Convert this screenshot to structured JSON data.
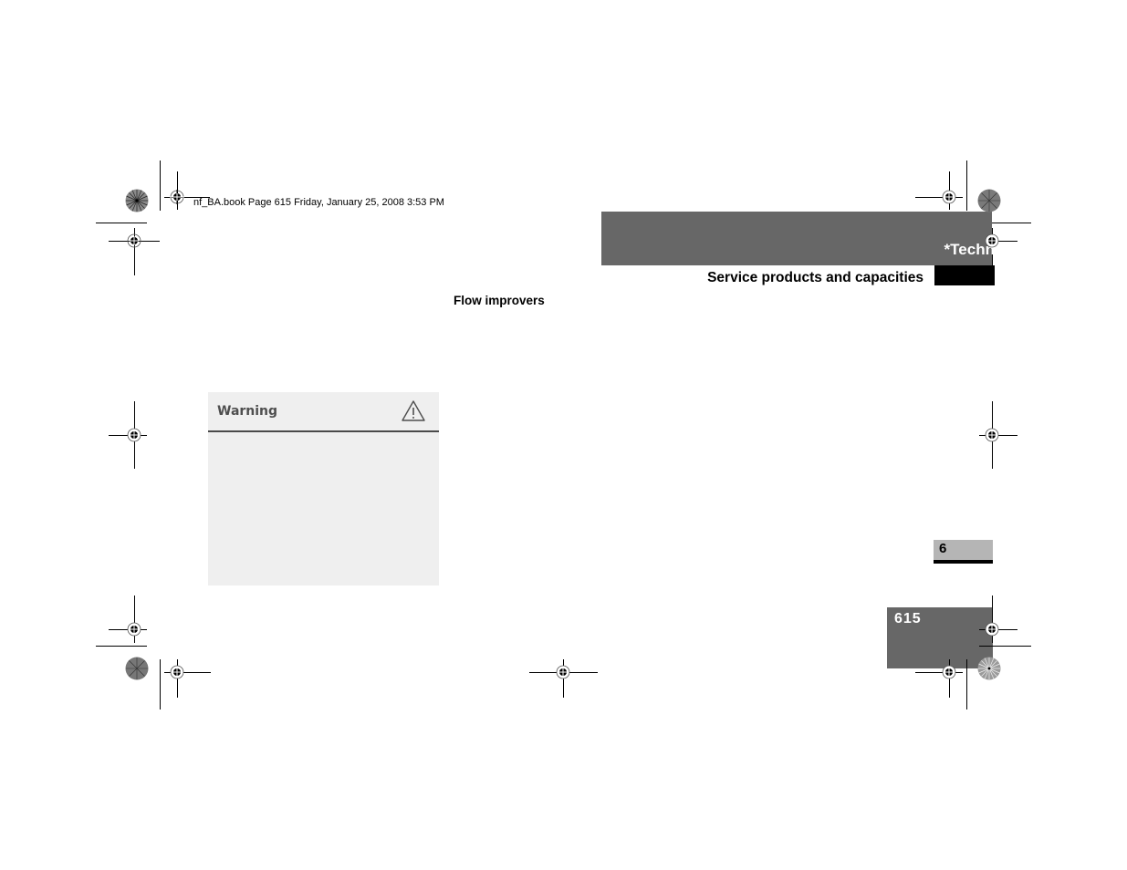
{
  "header": {
    "file_info": "nf_BA.book  Page 615  Friday, January 25, 2008  3:53 PM",
    "chapter_title": "*Technical data",
    "section_title": "Service products and capacities"
  },
  "content": {
    "subheading": "Flow improvers",
    "warning": {
      "label": "Warning",
      "icon": "warning-triangle-icon",
      "body": ""
    }
  },
  "side_tab": {
    "chapter_number": "6"
  },
  "footer": {
    "page_number": "615"
  },
  "colors": {
    "band_gray": "#676767",
    "tab_gray": "#b5b5b5",
    "warning_bg": "#efefef",
    "warning_text": "#4e4e4e"
  }
}
